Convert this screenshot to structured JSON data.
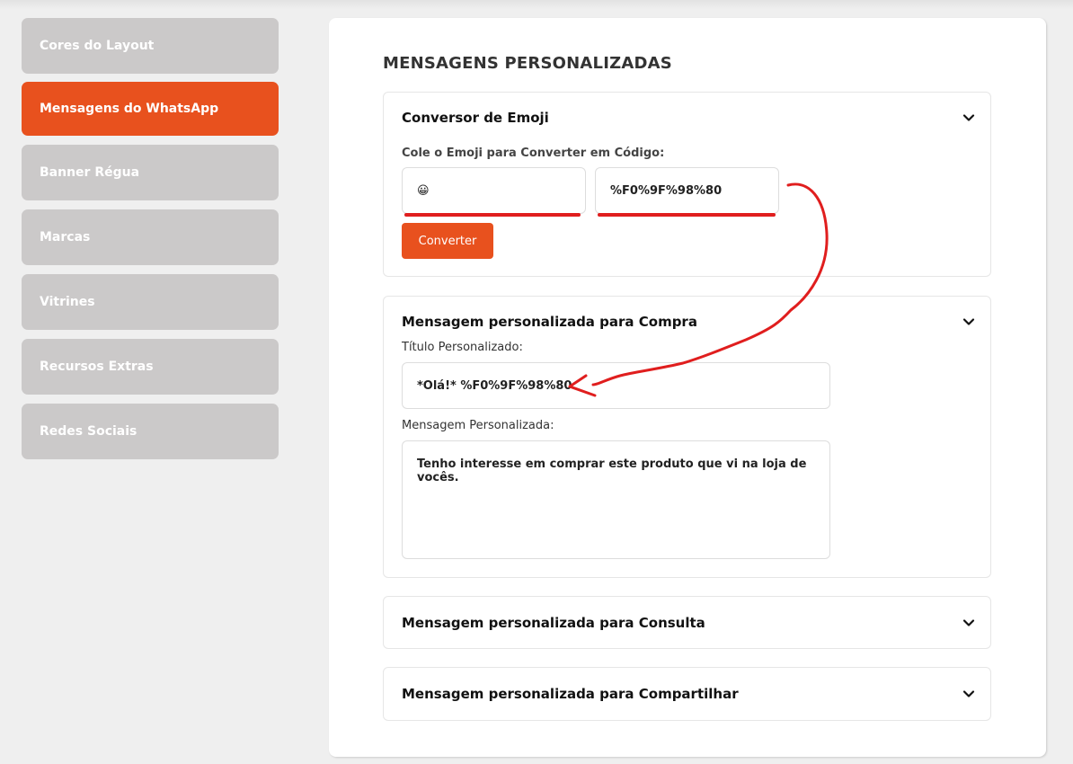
{
  "sidebar": {
    "items": [
      {
        "label": "Cores do Layout"
      },
      {
        "label": "Mensagens do WhatsApp"
      },
      {
        "label": "Banner Régua"
      },
      {
        "label": "Marcas"
      },
      {
        "label": "Vitrines"
      },
      {
        "label": "Recursos Extras"
      },
      {
        "label": "Redes Sociais"
      }
    ],
    "active_index": 1
  },
  "main": {
    "title": "MENSAGENS PERSONALIZADAS",
    "emoji_panel": {
      "title": "Conversor de Emoji",
      "field_label": "Cole o Emoji para Converter em Código:",
      "emoji_value": "😀",
      "code_value": "%F0%9F%98%80",
      "button_label": "Converter"
    },
    "purchase_panel": {
      "title": "Mensagem personalizada para Compra",
      "title_label": "Título Personalizado:",
      "title_value": "*Olá!* %F0%9F%98%80",
      "message_label": "Mensagem Personalizada:",
      "message_value": "Tenho interesse em comprar este produto que vi na loja de vocês."
    },
    "consult_panel": {
      "title": "Mensagem personalizada para Consulta"
    },
    "share_panel": {
      "title": "Mensagem personalizada para Compartilhar"
    }
  },
  "colors": {
    "accent": "#e8511e",
    "sidebar_inactive": "#cbc9c9",
    "annotation": "#e01e1e"
  },
  "icons": [
    "chevron-down-icon"
  ]
}
